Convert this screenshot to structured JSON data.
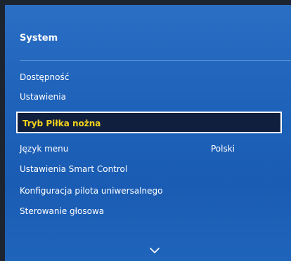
{
  "panel": {
    "title": "System"
  },
  "menu": {
    "items": [
      {
        "label": "Dostępność"
      },
      {
        "label": "Ustawienia"
      },
      {
        "label": "Tryb Piłka nożna"
      },
      {
        "label": "Język menu",
        "value": "Polski"
      },
      {
        "label": "Ustawienia Smart Control"
      },
      {
        "label": "Konfiguracja pilota uniwersalnego"
      },
      {
        "label": "Sterowanie głosowa"
      }
    ],
    "selected_index": 2
  },
  "icons": {
    "scroll_down": "chevron-down-icon"
  },
  "colors": {
    "panel_blue": "#1f63bb",
    "selected_bg": "#0f1f3d",
    "selected_text": "#f4d21c",
    "text": "#ffffff"
  }
}
